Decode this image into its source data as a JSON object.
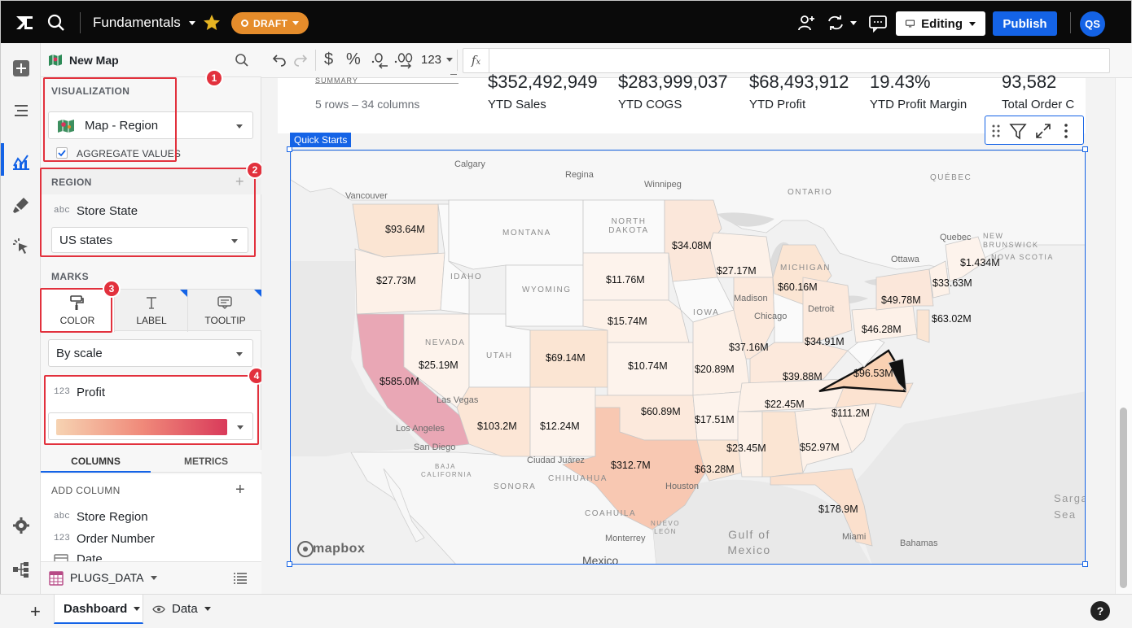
{
  "header": {
    "workbook_title": "Fundamentals",
    "draft_badge": "DRAFT",
    "editing_label": "Editing",
    "publish_label": "Publish",
    "avatar_initials": "QS",
    "accent_color": "#1463e6",
    "draft_color": "#e58c2b"
  },
  "rail": {
    "icons": [
      "add-icon",
      "text-icon",
      "chart-icon",
      "brush-icon",
      "cursor-icon",
      "settings-icon",
      "hierarchy-icon"
    ]
  },
  "panel": {
    "element_name": "New Map",
    "visualization": {
      "heading": "VISUALIZATION",
      "chart_type": "Map - Region",
      "aggregate_label": "AGGREGATE VALUES",
      "aggregate_checked": true
    },
    "region": {
      "heading": "REGION",
      "field_type": "abc",
      "field_name": "Store State",
      "region_type": "US states"
    },
    "marks": {
      "heading": "MARKS",
      "tabs": [
        "COLOR",
        "LABEL",
        "TOOLTIP"
      ],
      "color_mode": "By scale",
      "color_field_type": "123",
      "color_field_name": "Profit",
      "scale_start": "#f6d3b2",
      "scale_end": "#d93a5a"
    },
    "data_tabs": [
      "COLUMNS",
      "METRICS"
    ],
    "add_column_label": "ADD COLUMN",
    "columns": [
      {
        "type": "abc",
        "name": "Store Region"
      },
      {
        "type": "123",
        "name": "Order Number"
      },
      {
        "type": "date",
        "name": "Date"
      }
    ],
    "source_name": "PLUGS_DATA"
  },
  "toolbar": {
    "number_format": "123",
    "formula_placeholder": ""
  },
  "summary": {
    "partial_label": "SUMMARY",
    "rows_columns": "5 rows – 34 columns",
    "kpis": [
      {
        "value": "$352,492,949",
        "label": "YTD Sales"
      },
      {
        "value": "$283,999,037",
        "label": "YTD COGS"
      },
      {
        "value": "$68,493,912",
        "label": "YTD Profit"
      },
      {
        "value": "19.43%",
        "label": "YTD Profit Margin"
      },
      {
        "value": "93,582",
        "label": "Total Order C"
      }
    ]
  },
  "map": {
    "tag": "Quick Starts",
    "attribution": "mapbox",
    "places": [
      "Calgary",
      "Regina",
      "Winnipeg",
      "Vancouver",
      "ONTARIO",
      "QUÉBEC",
      "NORTH DAKOTA",
      "MONTANA",
      "Quebec",
      "NEW BRUNSWICK",
      "NOVA SCOTIA",
      "Ottawa",
      "IDAHO",
      "WYOMING",
      "MICHIGAN",
      "Madison",
      "Chicago",
      "Detroit",
      "IOWA",
      "NEVADA",
      "UTAH",
      "Las Vegas",
      "Los Angeles",
      "San Diego",
      "BAJA CALIFORNIA",
      "SONORA",
      "Ciudad Juárez",
      "CHIHUAHUA",
      "COAHUILA",
      "NUEVO LEÓN",
      "Monterrey",
      "Houston",
      "Mexico",
      "Gulf of Mexico",
      "Miami",
      "Bahamas",
      "Sargasso Sea"
    ],
    "region_labels": [
      {
        "state": "WA",
        "label": "$93.64M"
      },
      {
        "state": "OR",
        "label": "$27.73M"
      },
      {
        "state": "CA",
        "label": "$585.0M"
      },
      {
        "state": "NV",
        "label": "$25.19M"
      },
      {
        "state": "AZ",
        "label": "$103.2M"
      },
      {
        "state": "NM",
        "label": "$12.24M"
      },
      {
        "state": "CO",
        "label": "$69.14M"
      },
      {
        "state": "SD",
        "label": "$11.76M"
      },
      {
        "state": "NE",
        "label": "$15.74M"
      },
      {
        "state": "KS",
        "label": "$10.74M"
      },
      {
        "state": "OK",
        "label": "$60.89M"
      },
      {
        "state": "TX",
        "label": "$312.7M"
      },
      {
        "state": "MN",
        "label": "$34.08M"
      },
      {
        "state": "WI",
        "label": "$27.17M"
      },
      {
        "state": "MI",
        "label": "$60.16M"
      },
      {
        "state": "MO",
        "label": "$20.89M"
      },
      {
        "state": "IL",
        "label": "$37.16M"
      },
      {
        "state": "OH",
        "label": "$34.91M"
      },
      {
        "state": "KY",
        "label": "$39.88M"
      },
      {
        "state": "TN",
        "label": "$22.45M"
      },
      {
        "state": "AR",
        "label": "$17.51M"
      },
      {
        "state": "MS",
        "label": "$23.45M"
      },
      {
        "state": "LA",
        "label": "$63.28M"
      },
      {
        "state": "AL",
        "label": "$52.97M"
      },
      {
        "state": "NC",
        "label": "$111.2M"
      },
      {
        "state": "VA",
        "label": "$96.53M"
      },
      {
        "state": "PA",
        "label": "$46.28M"
      },
      {
        "state": "NY",
        "label": "$49.78M"
      },
      {
        "state": "VT",
        "label": "$33.63M"
      },
      {
        "state": "ME",
        "label": "$1.434M"
      },
      {
        "state": "NJ",
        "label": "$63.02M"
      },
      {
        "state": "FL",
        "label": "$178.9M"
      }
    ]
  },
  "footer": {
    "tabs": [
      {
        "label": "Dashboard",
        "active": true
      },
      {
        "label": "Data",
        "active": false
      }
    ],
    "help_label": "?"
  },
  "annotations": [
    "1",
    "2",
    "3",
    "4"
  ]
}
